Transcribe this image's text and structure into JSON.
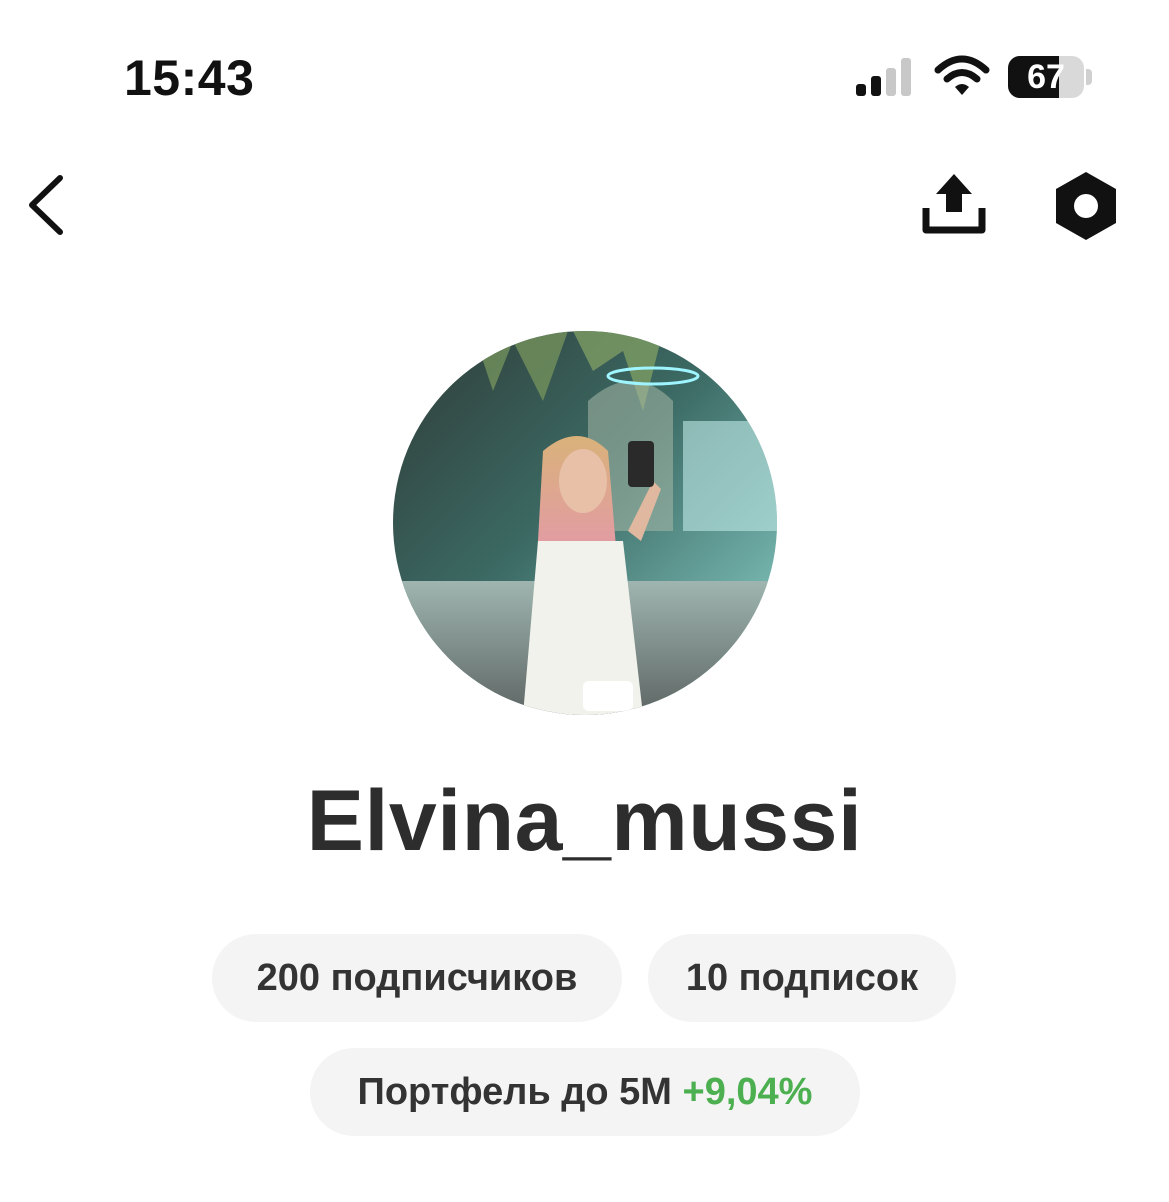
{
  "status_bar": {
    "time": "15:43",
    "battery": "67",
    "battery_level": 0.67,
    "signal_icon": "cellular-signal-icon",
    "wifi_icon": "wifi-icon"
  },
  "nav": {
    "back_icon": "chevron-left-icon",
    "share_icon": "share-upload-icon",
    "settings_icon": "hexagon-settings-icon"
  },
  "profile": {
    "avatar": "profile-photo",
    "username": "Elvina_mussi",
    "followers": "200 подписчиков",
    "following": "10 подписок",
    "portfolio_label": "Портфель до 5М",
    "portfolio_change": "+9,04%"
  },
  "colors": {
    "gain": "#4caf50",
    "pill_bg": "#f4f4f4",
    "text": "#333333"
  }
}
